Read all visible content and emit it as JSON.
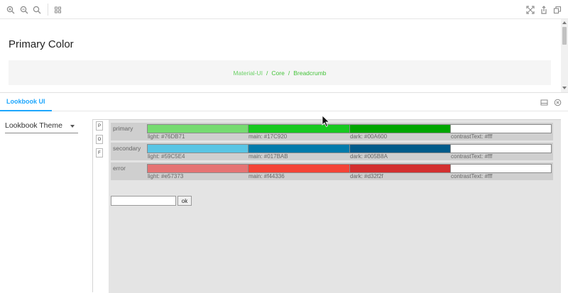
{
  "toolbar": {
    "left_icons": [
      "zoom-in-icon",
      "zoom-out-icon",
      "zoom-reset-icon",
      "grid-icon"
    ],
    "right_icons": [
      "fullscreen-icon",
      "share-icon",
      "copy-icon"
    ]
  },
  "preview": {
    "title": "Primary Color",
    "breadcrumb": {
      "items": [
        "Material-UI",
        "Core",
        "Breadcrumb"
      ],
      "separator": "/"
    },
    "colors": {
      "link": "#6bd166",
      "text": "#45c33a",
      "box_bg": "#f5f5f5"
    }
  },
  "panel": {
    "tab_label": "Lookbook UI",
    "accent": "#1ea7fd",
    "controls": [
      "panel-toggle-icon",
      "close-panel-icon"
    ]
  },
  "theme_select": {
    "value": "Lookbook Theme"
  },
  "mini_tabs": [
    "P",
    "O",
    "F"
  ],
  "palette": {
    "rows": [
      {
        "name": "primary",
        "swatches": [
          {
            "label": "light: #76DB71",
            "color": "#76DB71"
          },
          {
            "label": "main: #17C920",
            "color": "#17C920"
          },
          {
            "label": "dark: #00A600",
            "color": "#00A600"
          },
          {
            "label": "contrastText: #fff",
            "color": "#ffffff"
          }
        ]
      },
      {
        "name": "secondary",
        "swatches": [
          {
            "label": "light: #59C5E4",
            "color": "#59C5E4"
          },
          {
            "label": "main: #017BAB",
            "color": "#017BAB"
          },
          {
            "label": "dark: #005B8A",
            "color": "#005B8A"
          },
          {
            "label": "contrastText: #fff",
            "color": "#ffffff"
          }
        ]
      },
      {
        "name": "error",
        "swatches": [
          {
            "label": "light: #e57373",
            "color": "#e57373"
          },
          {
            "label": "main: #f44336",
            "color": "#f44336"
          },
          {
            "label": "dark: #d32f2f",
            "color": "#d32f2f"
          },
          {
            "label": "contrastText: #fff",
            "color": "#ffffff"
          }
        ]
      }
    ]
  },
  "color_input": {
    "value": ""
  },
  "ok_button": {
    "label": "ok"
  }
}
